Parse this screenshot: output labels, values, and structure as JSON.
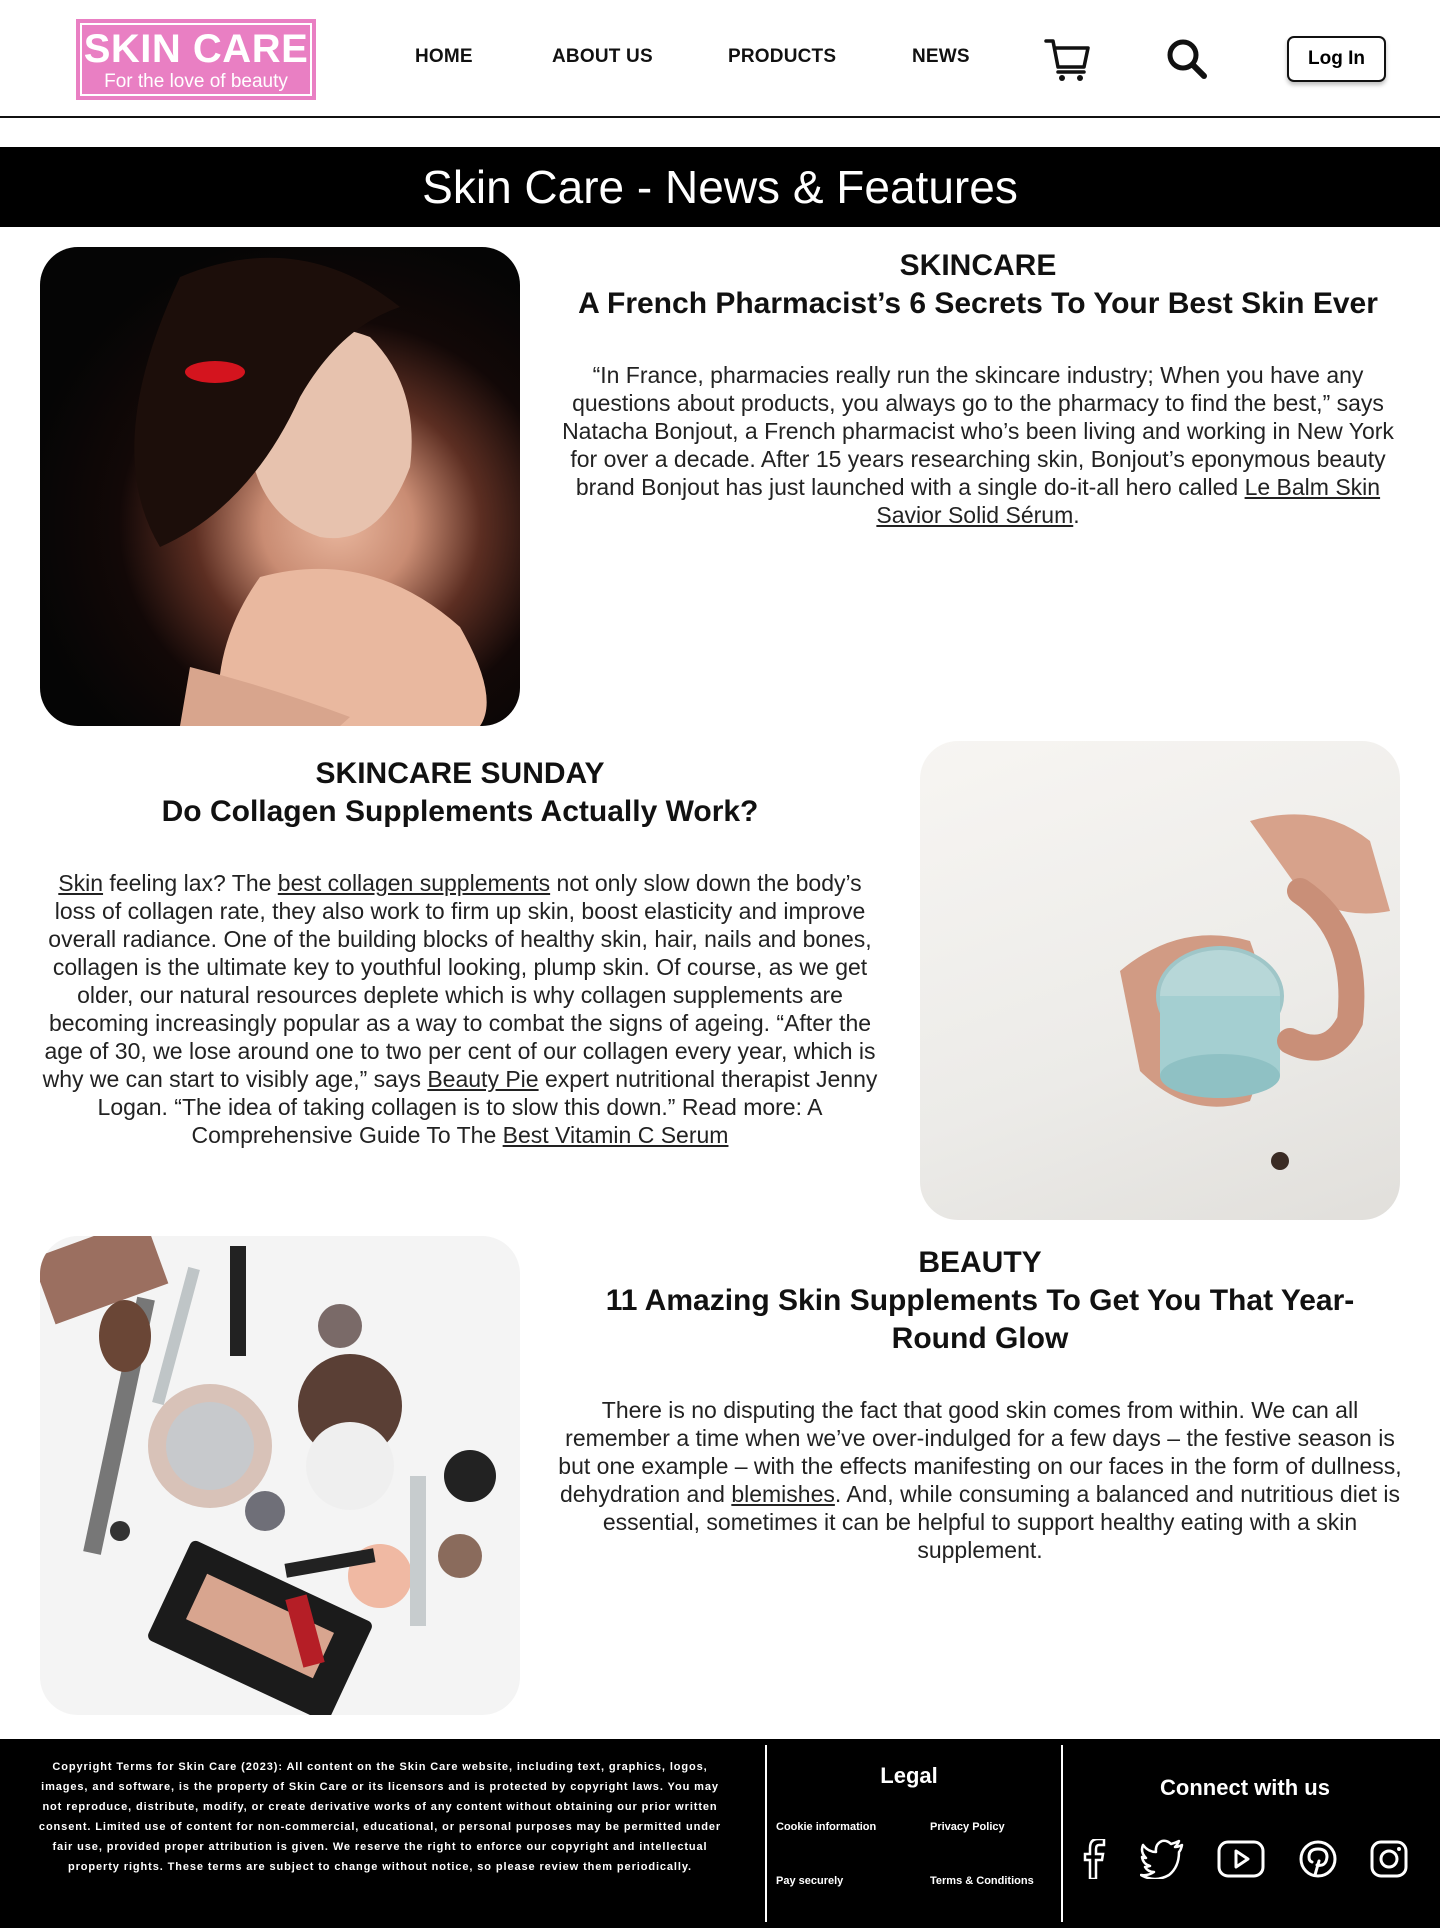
{
  "header": {
    "logo": {
      "title": "SKIN CARE",
      "subtitle": "For the love of beauty"
    },
    "nav": [
      "HOME",
      "ABOUT US",
      "PRODUCTS",
      "NEWS"
    ],
    "login_label": "Log In"
  },
  "banner": {
    "title": "Skin Care - News & Features"
  },
  "articles": [
    {
      "kicker": "SKINCARE",
      "headline": "A French Pharmacist’s 6 Secrets To Your Best Skin Ever",
      "body_1": "“In France, pharmacies really run the skincare industry; When you have any questions about products, you always go to the pharmacy to find the best,” says Natacha Bonjout, a French pharmacist who’s been living and working in New York for over a decade. After 15 years researching skin, Bonjout’s eponymous beauty brand Bonjout has just launched with a single do-it-all hero called ",
      "link_1": "Le Balm Skin Savior Solid Sérum",
      "body_2": "."
    },
    {
      "kicker": "SKINCARE SUNDAY",
      "headline": "Do Collagen Supplements Actually Work?",
      "link_1": "Skin",
      "body_1": " feeling lax? The ",
      "link_2": "best collagen supplements",
      "body_2": " not only slow down the body’s loss of collagen rate, they also work to firm up skin, boost elasticity and improve overall radiance. One of the building blocks of healthy skin, hair, nails and bones, collagen is the ultimate key to youthful looking, plump skin. Of course, as we get older, our natural resources deplete which is why collagen supplements are becoming increasingly popular as a way to combat the signs of ageing. “After the age of 30, we lose around one to two per cent of our collagen every year, which is why we can start to visibly age,” says ",
      "link_3": "Beauty Pie",
      "body_3": " expert nutritional therapist Jenny Logan. “The idea of taking collagen is to slow this down.” Read more: A Comprehensive Guide To The ",
      "link_4": "Best Vitamin C Serum"
    },
    {
      "kicker": "BEAUTY",
      "headline": "11 Amazing Skin Supplements To Get You That Year-Round Glow",
      "body_1": "There is no disputing the fact that good skin comes from within. We can all remember a time when we’ve over-indulged for a few days – the festive season is but one example – with the effects manifesting on our faces in the form of dullness, dehydration and ",
      "link_1": "blemishes",
      "body_2": ". And, while consuming a balanced and nutritious diet is essential, sometimes it can be helpful to support healthy eating with a skin supplement."
    }
  ],
  "footer": {
    "copyright": "Copyright Terms for Skin Care (2023): All content on the Skin Care website, including text, graphics, logos, images, and software, is the property of Skin Care or its licensors and is protected by copyright laws. You may not reproduce, distribute, modify, or create derivative works of any content without obtaining our prior written consent. Limited use of content for non-commercial, educational, or personal purposes may be permitted under fair use, provided proper attribution is given. We reserve the right to enforce our copyright and intellectual property rights. These terms are subject to change without notice, so please review them periodically.",
    "legal_title": "Legal",
    "legal_links": [
      "Cookie information",
      "Privacy  Policy",
      "Pay securely",
      "Terms & Conditions"
    ],
    "connect_title": "Connect with us",
    "social_icons": [
      "facebook-icon",
      "twitter-icon",
      "youtube-icon",
      "pinterest-icon",
      "instagram-icon"
    ]
  },
  "colors": {
    "brand_pink": "#e97fc3",
    "banner_bg": "#000000",
    "footer_bg": "#000000"
  }
}
